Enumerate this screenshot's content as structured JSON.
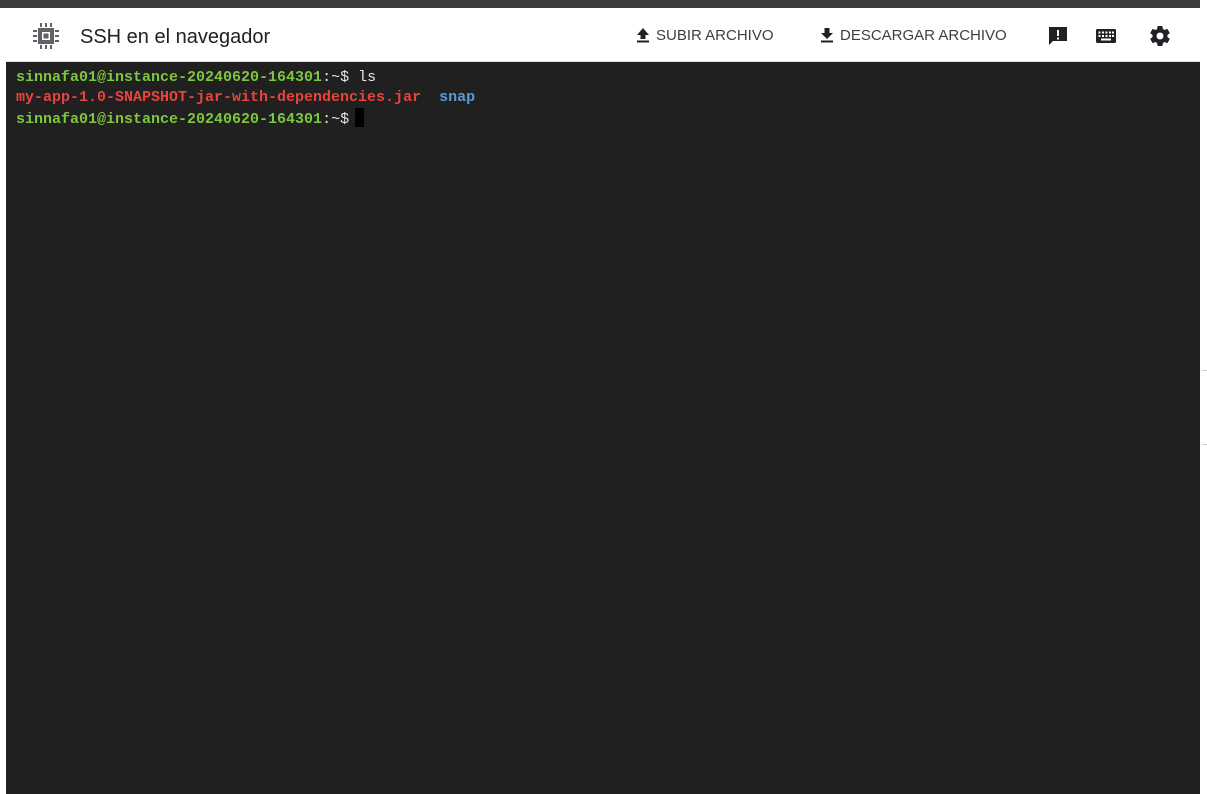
{
  "header": {
    "title": "SSH en el navegador",
    "upload_label": "SUBIR ARCHIVO",
    "download_label": "DESCARGAR ARCHIVO",
    "icons": [
      "chip-icon",
      "upload-icon",
      "download-icon",
      "feedback-icon",
      "keyboard-icon",
      "settings-icon"
    ]
  },
  "terminal": {
    "lines": [
      {
        "prompt_user": "sinnafa01@instance-20240620-164301",
        "prompt_path": ":~$ ",
        "command": "ls"
      },
      {
        "output_red": "my-app-1.0-SNAPSHOT-jar-with-dependencies.jar",
        "output_blue": "snap"
      },
      {
        "prompt_user": "sinnafa01@instance-20240620-164301",
        "prompt_path": ":~$",
        "command": ""
      }
    ]
  },
  "colors": {
    "terminal_bg": "#202020",
    "prompt_green": "#7ec63f",
    "file_red": "#e8443a",
    "dir_blue": "#5a9bd5",
    "header_bg": "#ffffff"
  }
}
